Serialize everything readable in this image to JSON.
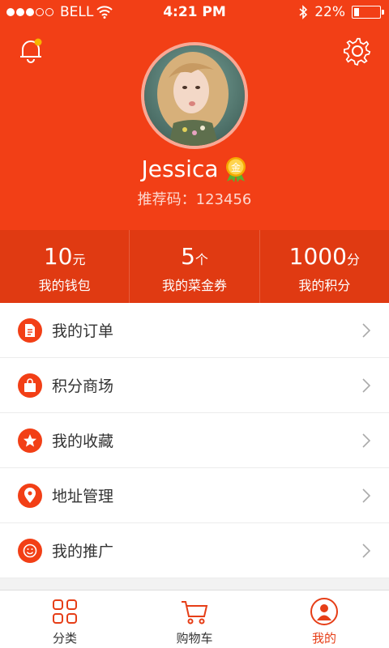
{
  "status_bar": {
    "carrier": "BELL",
    "time": "4:21 PM",
    "battery": "22%",
    "battery_level": 0.22
  },
  "profile": {
    "name": "Jessica",
    "badge_text": "金",
    "referral": "推荐码：123456"
  },
  "stats": [
    {
      "value": "10",
      "unit": "元",
      "label": "我的钱包"
    },
    {
      "value": "5",
      "unit": "个",
      "label": "我的菜金券"
    },
    {
      "value": "1000",
      "unit": "分",
      "label": "我的积分"
    }
  ],
  "menu": [
    {
      "label": "我的订单",
      "icon": "order-icon"
    },
    {
      "label": "积分商场",
      "icon": "shopping-bag-icon"
    },
    {
      "label": "我的收藏",
      "icon": "star-icon"
    },
    {
      "label": "地址管理",
      "icon": "location-pin-icon"
    },
    {
      "label": "我的推广",
      "icon": "smiley-icon"
    }
  ],
  "tabs": [
    {
      "label": "分类",
      "icon": "grid-icon",
      "active": false
    },
    {
      "label": "购物车",
      "icon": "cart-icon",
      "active": false
    },
    {
      "label": "我的",
      "icon": "user-icon",
      "active": true
    }
  ],
  "colors": {
    "primary": "#f23f16",
    "stats_bg": "#e03a12",
    "active_tab": "#e63e17"
  }
}
